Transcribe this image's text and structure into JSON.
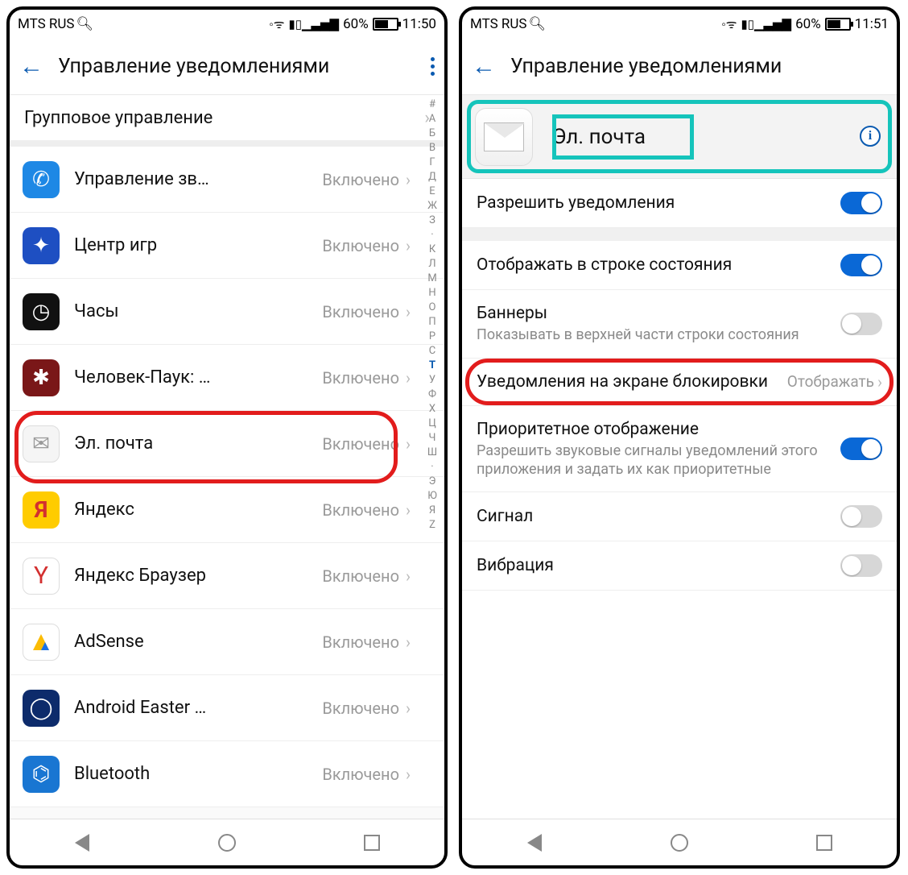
{
  "left": {
    "status": {
      "carrier": "MTS RUS",
      "battery": "60%",
      "time": "11:50"
    },
    "header": {
      "title": "Управление уведомлениями"
    },
    "group_row": "Групповое управление",
    "status_enabled": "Включено",
    "apps": [
      {
        "name": "Управление зв…",
        "icon": "phone"
      },
      {
        "name": "Центр игр",
        "icon": "puzzle"
      },
      {
        "name": "Часы",
        "icon": "clock"
      },
      {
        "name": "Человек-Паук: …",
        "icon": "spider"
      },
      {
        "name": "Эл. почта",
        "icon": "mail",
        "hl": true
      },
      {
        "name": "Яндекс",
        "icon": "ya"
      },
      {
        "name": "Яндекс Браузер",
        "icon": "yb"
      },
      {
        "name": "AdSense",
        "icon": "ad"
      },
      {
        "name": "Android Easter …",
        "icon": "ae"
      },
      {
        "name": "Bluetooth",
        "icon": "bt"
      }
    ],
    "index": [
      "#",
      "А",
      "Б",
      "В",
      "Г",
      "Д",
      "Е",
      "Ж",
      "З",
      "·",
      "К",
      "Л",
      "М",
      "Н",
      "О",
      "П",
      "Р",
      "С",
      "Т",
      "У",
      "Ф",
      "Х",
      "Ц",
      "Ч",
      "Ш",
      "·",
      "Э",
      "Ю",
      "Я",
      "Z"
    ],
    "index_active": "Т"
  },
  "right": {
    "status": {
      "carrier": "MTS RUS",
      "battery": "60%",
      "time": "11:51"
    },
    "header": {
      "title": "Управление уведомлениями"
    },
    "app_name": "Эл. почта",
    "rows": {
      "allow": "Разрешить уведомления",
      "statusbar": "Отображать в строке состояния",
      "banners": "Баннеры",
      "banners_sub": "Показывать в верхней части строки состояния",
      "lockscreen": "Уведомления на экране блокировки",
      "lockscreen_val": "Отображать",
      "priority": "Приоритетное отображение",
      "priority_sub": "Разрешить звуковые сигналы уведомлений этого приложения и задать их как приоритетные",
      "signal": "Сигнал",
      "vibration": "Вибрация"
    },
    "toggles": {
      "allow": true,
      "statusbar": true,
      "banners": false,
      "priority": true,
      "signal": false,
      "vibration": false
    }
  }
}
